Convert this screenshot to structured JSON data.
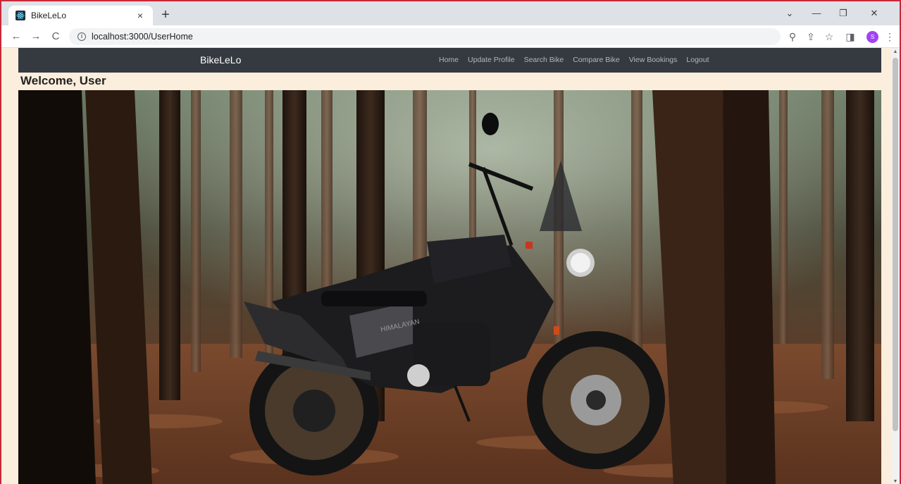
{
  "browser": {
    "tab_title": "BikeLeLo",
    "tab_close": "×",
    "new_tab": "+",
    "url": "localhost:3000/UserHome",
    "avatar_initial": "S",
    "window_controls": {
      "dropdown": "⌄",
      "minimize": "—",
      "restore": "❐",
      "close": "✕"
    },
    "nav": {
      "back": "←",
      "forward": "→",
      "reload": "C"
    },
    "toolbar_icons": {
      "zoom": "⚲",
      "share": "⇪",
      "bookmark": "☆",
      "sidepanel": "◨",
      "menu": "⋮"
    }
  },
  "navbar": {
    "brand": "BikeLeLo",
    "links": [
      {
        "label": "Home"
      },
      {
        "label": "Update Profile"
      },
      {
        "label": "Search Bike"
      },
      {
        "label": "Compare Bike"
      },
      {
        "label": "View Bookings"
      },
      {
        "label": "Logout"
      }
    ]
  },
  "page": {
    "welcome": "Welcome, User"
  },
  "hero": {
    "bike_badge": "HIMALAYAN"
  }
}
